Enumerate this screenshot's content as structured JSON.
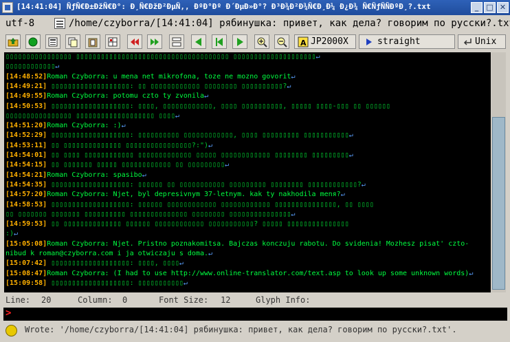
{
  "window": {
    "title": "[14:41:04] ÑƒÑ€Ð±ÐžÑ€Ð°: Ð¸Ñ€ÐžÐ²ÐµÑ‚, ÐºÐ°Ðº Ð´ÐµÐ»Ð°? Ð³Ð¾Ð²Ð¾Ñ€Ð¸Ð¼ Ð¿Ð¾ Ñ€ÑƒÑÑÐºÐ¸?.txt",
    "min_label": "_",
    "max_label": "□",
    "close_label": "✕"
  },
  "pathbar": {
    "encoding": "utf-8",
    "path": "/home/czyborra/[14:41:04] рябинушка: привет, как дела? говорим по русски?.txt"
  },
  "toolbar": {
    "font_button": "JP2000X",
    "mode_button": "straight",
    "lineend_button": "Unix"
  },
  "editor": {
    "lines": [
      {
        "ts": "",
        "name": "",
        "msg": "",
        "garb": "▯▯▯▯▯▯▯▯▯▯▯▯▯▯▯▯ ▯▯▯▯▯▯▯▯▯▯▯▯▯▯▯▯▯▯▯▯▯▯▯▯▯▯▯▯▯▯▯▯▯▯▯▯▯ ▯▯▯▯▯▯▯▯▯▯▯▯▯▯▯▯▯▯▯▯",
        "eol": "↵"
      },
      {
        "ts": "",
        "name": "",
        "msg": "",
        "garb": "▯▯▯▯▯▯▯▯▯▯▯▯",
        "eol": "↵"
      },
      {
        "ts": "[14:48:52]",
        "name": "Roman Czyborra:",
        "msg": " u mena net mikrofona, toze ne mozno govorit",
        "garb": "",
        "eol": "↵"
      },
      {
        "ts": "[14:49:21]",
        "name": "",
        "msg": "",
        "garb": " ▯▯▯▯▯▯▯▯▯▯▯▯▯▯▯▯▯▯▯: ▯▯ ▯▯▯▯▯▯▯▯▯▯▯▯ ▯▯▯▯▯▯▯▯ ▯▯▯▯▯▯▯▯▯▯?",
        "eol": "↵"
      },
      {
        "ts": "[14:49:55]",
        "name": "Roman Czyborra:",
        "msg": " potomu czto ty zvonila",
        "garb": "",
        "eol": "↵"
      },
      {
        "ts": "[14:50:53]",
        "name": "",
        "msg": "",
        "garb": " ▯▯▯▯▯▯▯▯▯▯▯▯▯▯▯▯▯▯▯: ▯▯▯▯, ▯▯▯▯▯▯▯▯▯▯▯▯, ▯▯▯▯ ▯▯▯▯▯▯▯▯▯▯, ▯▯▯▯▯ ▯▯▯▯-▯▯▯ ▯▯ ▯▯▯▯▯▯",
        "eol": ""
      },
      {
        "ts": "",
        "name": "",
        "msg": "",
        "garb": "▯▯▯▯▯▯▯▯▯▯▯▯▯▯▯▯ ▯▯▯▯▯▯▯▯▯▯▯▯▯▯▯▯▯▯▯ ▯▯▯▯",
        "eol": "↵"
      },
      {
        "ts": "[14:51:20]",
        "name": "Roman Czyborra:",
        "msg": " :)",
        "garb": "",
        "eol": "↵"
      },
      {
        "ts": "[14:52:29]",
        "name": "",
        "msg": "",
        "garb": " ▯▯▯▯▯▯▯▯▯▯▯▯▯▯▯▯▯▯▯: ▯▯▯▯▯▯▯▯▯▯ ▯▯▯▯▯▯▯▯▯▯▯▯, ▯▯▯▯ ▯▯▯▯▯▯▯▯▯ ▯▯▯▯▯▯▯▯▯▯▯",
        "eol": "↵"
      },
      {
        "ts": "[14:53:11]",
        "name": "",
        "msg": "",
        "garb": " ▯▯ ▯▯▯▯▯▯▯▯▯▯▯▯▯▯ ▯▯▯▯▯▯▯▯▯▯▯▯▯▯▯▯?:\")",
        "eol": "↵"
      },
      {
        "ts": "[14:54:01]",
        "name": "",
        "msg": "",
        "garb": " ▯▯ ▯▯▯▯ ▯▯▯▯▯▯▯▯▯▯▯▯ ▯▯▯▯▯▯▯▯▯▯▯▯▯ ▯▯▯▯▯ ▯▯▯▯▯▯▯▯▯▯▯▯ ▯▯▯▯▯▯▯▯ ▯▯▯▯▯▯▯▯▯",
        "eol": "↵"
      },
      {
        "ts": "[14:54:15]",
        "name": "",
        "msg": "",
        "garb": " ▯▯ ▯▯▯▯▯▯▯ ▯▯▯▯▯ ▯▯▯▯▯▯▯▯▯▯▯▯ ▯▯ ▯▯▯▯▯▯▯▯▯",
        "eol": "↵"
      },
      {
        "ts": "[14:54:21]",
        "name": "Roman Czyborra:",
        "msg": " spasibo",
        "garb": "",
        "eol": "↵"
      },
      {
        "ts": "[14:54:35]",
        "name": "",
        "msg": "",
        "garb": " ▯▯▯▯▯▯▯▯▯▯▯▯▯▯▯▯▯▯▯: ▯▯▯▯▯▯ ▯▯ ▯▯▯▯▯▯▯▯▯▯▯ ▯▯▯▯▯▯▯▯▯ ▯▯▯▯▯▯▯▯ ▯▯▯▯▯▯▯▯▯▯▯▯?",
        "eol": "↵"
      },
      {
        "ts": "[14:57:20]",
        "name": "Roman Czyborra:",
        "msg": " Njet, byl depresivnym 37-letnym.  kak ty nakhodila menя?",
        "garb": "",
        "eol": "↵"
      },
      {
        "ts": "[14:58:53]",
        "name": "",
        "msg": "",
        "garb": " ▯▯▯▯▯▯▯▯▯▯▯▯▯▯▯▯▯▯▯: ▯▯▯▯▯▯ ▯▯▯▯▯▯▯▯▯▯▯▯ ▯▯▯▯▯▯▯▯▯▯▯▯ ▯▯▯▯▯▯▯▯▯▯▯▯▯▯▯, ▯▯ ▯▯▯▯",
        "eol": ""
      },
      {
        "ts": "",
        "name": "",
        "msg": "",
        "garb": "▯▯ ▯▯▯▯▯▯▯ ▯▯▯▯▯▯▯ ▯▯▯▯▯▯▯▯▯▯ ▯▯▯▯▯▯▯▯▯▯▯▯▯▯ ▯▯▯▯▯▯▯▯ ▯▯▯▯▯▯▯▯▯▯▯▯▯▯▯",
        "eol": "↵"
      },
      {
        "ts": "[14:59:53]",
        "name": "",
        "msg": "",
        "garb": " ▯▯ ▯▯▯▯▯▯▯▯▯▯▯▯▯▯ ▯▯▯▯▯▯ ▯▯▯▯▯▯▯▯▯▯▯▯ ▯▯▯▯▯▯▯▯▯▯▯? ▯▯▯▯▯ ▯▯▯▯▯▯▯▯▯▯▯▯▯▯▯",
        "eol": ""
      },
      {
        "ts": "",
        "name": "",
        "msg": "",
        "garb": ":)",
        "eol": "↵"
      },
      {
        "ts": "[15:05:08]",
        "name": "Roman Czyborra:",
        "msg": " Njet.  Pristno poznakomitsa.  Bajczas konczuju rabotu.  Do svidenia!  Mozhesz pisat' czto-",
        "garb": "",
        "eol": ""
      },
      {
        "ts": "",
        "name": "",
        "msg": "nibud k roman@czyborra.com i ja otwiczaju s doma.",
        "garb": "",
        "eol": "↵"
      },
      {
        "ts": "[15:07:42]",
        "name": "",
        "msg": "",
        "garb": " ▯▯▯▯▯▯▯▯▯▯▯▯▯▯▯▯▯▯▯: ▯▯▯▯, ▯▯▯▯",
        "eol": "↵"
      },
      {
        "ts": "[15:08:47]",
        "name": "Roman Czyborra:",
        "msg": " (I had to use http://www.online-translator.com/text.asp to look up some unknown words)",
        "garb": "",
        "eol": "↵"
      },
      {
        "ts": "[15:09:58]",
        "name": "",
        "msg": "",
        "garb": " ▯▯▯▯▯▯▯▯▯▯▯▯▯▯▯▯▯▯▯: ▯▯▯▯▯▯▯▯▯▯▯",
        "eol": "↵"
      }
    ]
  },
  "status": {
    "line_label": "Line:",
    "line_value": "20",
    "column_label": "Column:",
    "column_value": "0",
    "font_size_label": "Font Size:",
    "font_size_value": "12",
    "glyph_info_label": "Glyph Info:"
  },
  "cmdline": {
    "prompt": ">"
  },
  "message": {
    "text": "Wrote: '/home/czyborra/[14:41:04] рябинушка: привет, как дела? говорим по русски?.txt'."
  },
  "colors": {
    "timestamp": "#ffb000",
    "text": "#00ff40",
    "eol": "#5aa0ff",
    "title_bg": "#2e61b8"
  }
}
